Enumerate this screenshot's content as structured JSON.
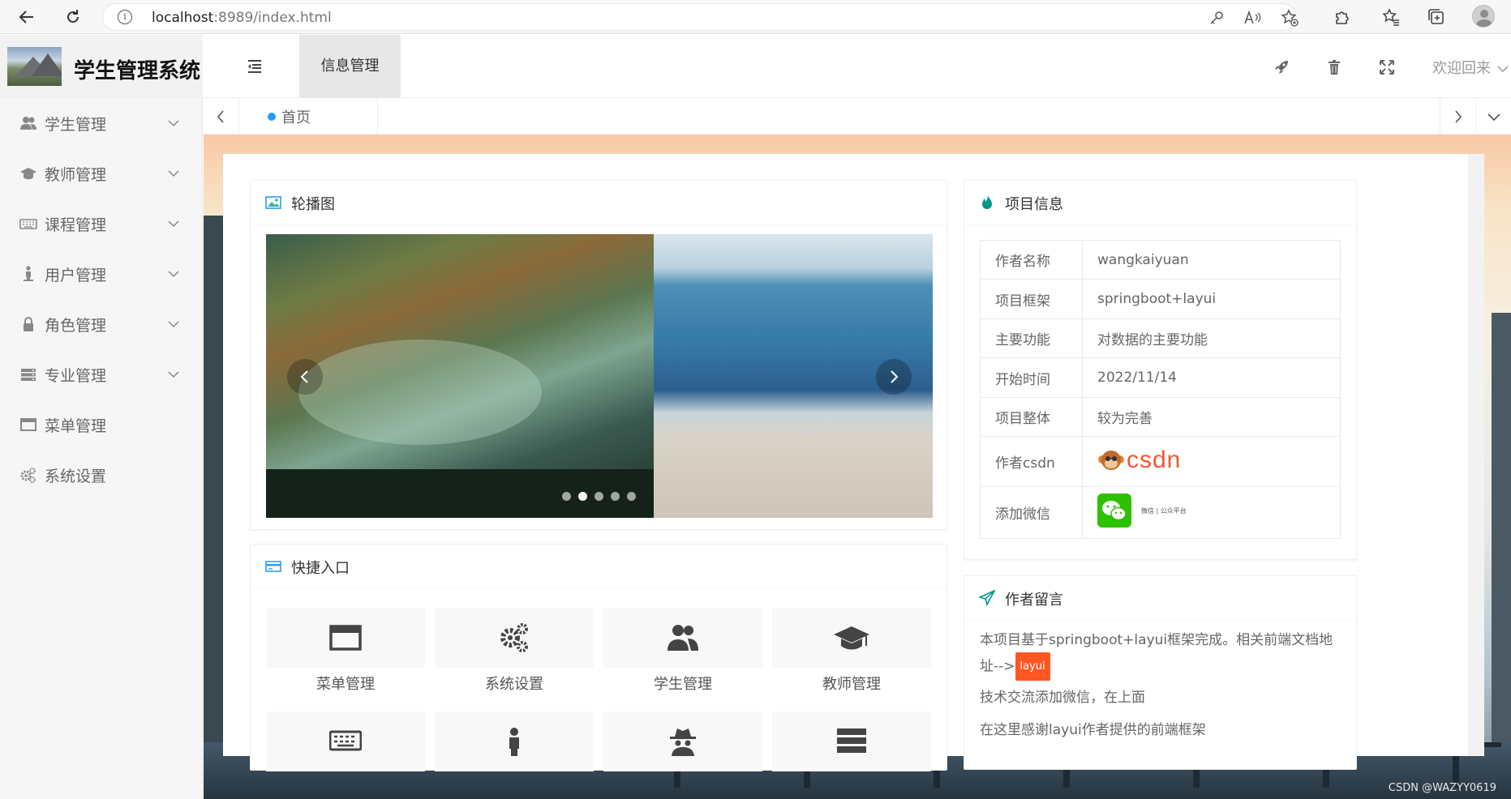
{
  "browser": {
    "url_host": "localhost",
    "url_rest": ":8989/index.html"
  },
  "header": {
    "app_title": "学生管理系统",
    "active_tab": "信息管理",
    "welcome": "欢迎回来"
  },
  "sidebar": {
    "items": [
      {
        "label": "学生管理",
        "icon": "users-icon",
        "expandable": true
      },
      {
        "label": "教师管理",
        "icon": "graduation-cap-icon",
        "expandable": true
      },
      {
        "label": "课程管理",
        "icon": "keyboard-icon",
        "expandable": true
      },
      {
        "label": "用户管理",
        "icon": "user-icon",
        "expandable": true
      },
      {
        "label": "角色管理",
        "icon": "lock-icon",
        "expandable": true
      },
      {
        "label": "专业管理",
        "icon": "server-icon",
        "expandable": true
      },
      {
        "label": "菜单管理",
        "icon": "window-icon",
        "expandable": false
      },
      {
        "label": "系统设置",
        "icon": "gears-icon",
        "expandable": false
      }
    ]
  },
  "tabbar": {
    "home": "首页"
  },
  "carousel": {
    "title": "轮播图",
    "slide_count": 5,
    "active_index": 1
  },
  "quick": {
    "title": "快捷入口",
    "items": [
      {
        "label": "菜单管理",
        "icon": "window-icon"
      },
      {
        "label": "系统设置",
        "icon": "gears-icon"
      },
      {
        "label": "学生管理",
        "icon": "users-icon"
      },
      {
        "label": "教师管理",
        "icon": "graduation-cap-icon"
      }
    ],
    "second_row_icons": [
      "keyboard-icon",
      "user-icon",
      "spy-icon",
      "server-icon"
    ]
  },
  "project": {
    "title": "项目信息",
    "rows": [
      {
        "k": "作者名称",
        "v": "wangkaiyuan"
      },
      {
        "k": "项目框架",
        "v": "springboot+layui"
      },
      {
        "k": "主要功能",
        "v": "对数据的主要功能"
      },
      {
        "k": "开始时间",
        "v": "2022/11/14"
      },
      {
        "k": "项目整体",
        "v": "较为完善"
      },
      {
        "k": "作者csdn",
        "v": "CSDN"
      },
      {
        "k": "添加微信",
        "v": "微信 | 公众平台"
      }
    ]
  },
  "message": {
    "title": "作者留言",
    "line1a": "本项目基于springboot+layui框架完成。相关前端文档地",
    "line1b": "址-->",
    "tag": "layui",
    "line2": "技术交流添加微信，在上面",
    "line3": "在这里感谢layui作者提供的前端框架"
  },
  "watermark": "CSDN @WAZYY0619"
}
